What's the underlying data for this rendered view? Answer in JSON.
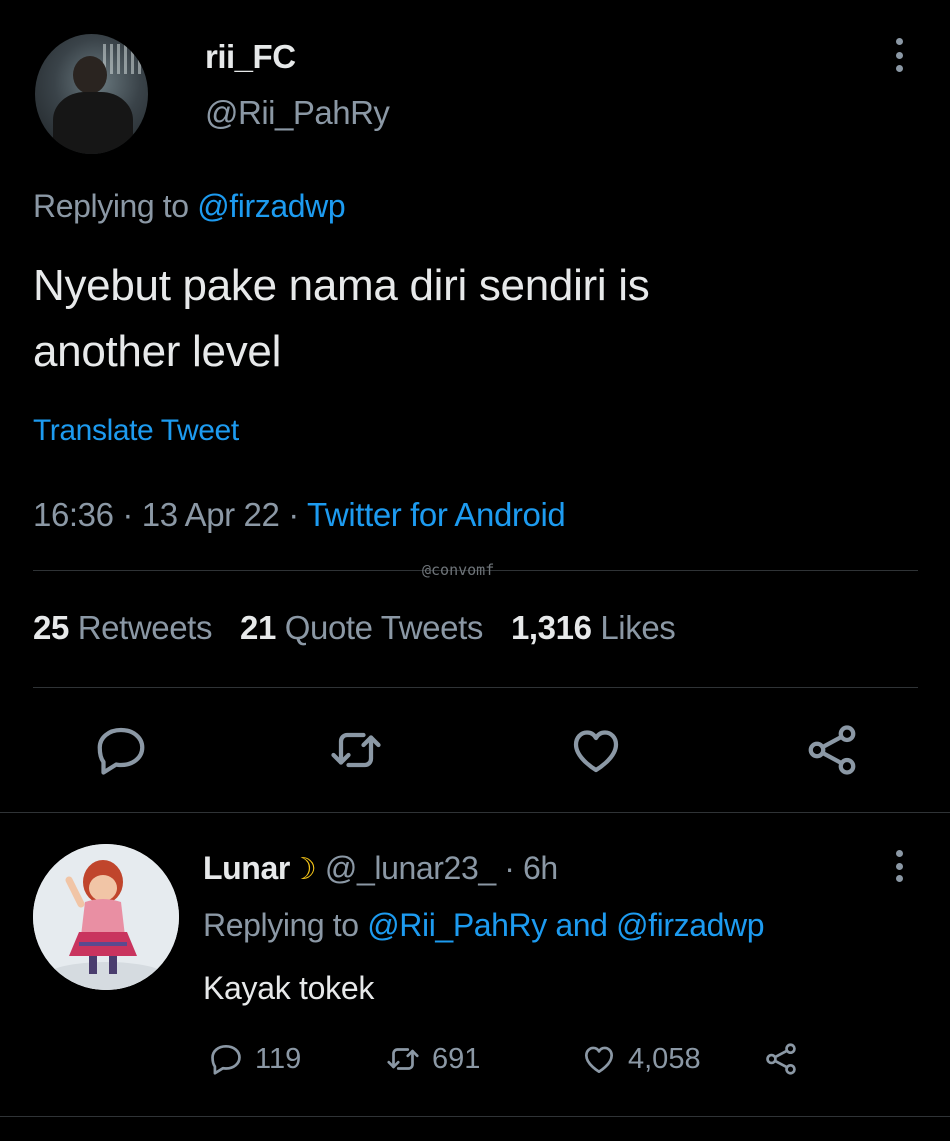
{
  "main_tweet": {
    "display_name": "rii_FC",
    "handle": "@Rii_PahRy",
    "replying_prefix": "Replying to",
    "replying_to": "@firzadwp",
    "text_line1": "Nyebut pake nama diri sendiri is",
    "text_line2": "another level",
    "translate_label": "Translate Tweet",
    "time": "16:36",
    "date": "13 Apr 22",
    "separator": "·",
    "source": "Twitter for Android",
    "watermark": "@convomf",
    "stats": {
      "retweets_count": "25",
      "retweets_label": "Retweets",
      "quotes_count": "21",
      "quotes_label": "Quote Tweets",
      "likes_count": "1,316",
      "likes_label": "Likes"
    }
  },
  "reply_tweet": {
    "display_name": "Lunar",
    "name_emoji": "☽",
    "handle": "@_lunar23_",
    "separator": "·",
    "age": "6h",
    "replying_prefix": "Replying to",
    "replying_to_1": "@Rii_PahRy",
    "replying_and": "and",
    "replying_to_2": "@firzadwp",
    "text": "Kayak tokek",
    "reply_count": "119",
    "retweet_count": "691",
    "like_count": "4,058"
  },
  "icons": {
    "reply": "reply-icon",
    "retweet": "retweet-icon",
    "like": "heart-icon",
    "share": "share-icon",
    "more": "more-vertical-icon"
  },
  "colors": {
    "background": "#000000",
    "text_primary": "#e7e9ea",
    "text_secondary": "#8b98a5",
    "link": "#1d9bf0",
    "divider": "#2f3336"
  }
}
